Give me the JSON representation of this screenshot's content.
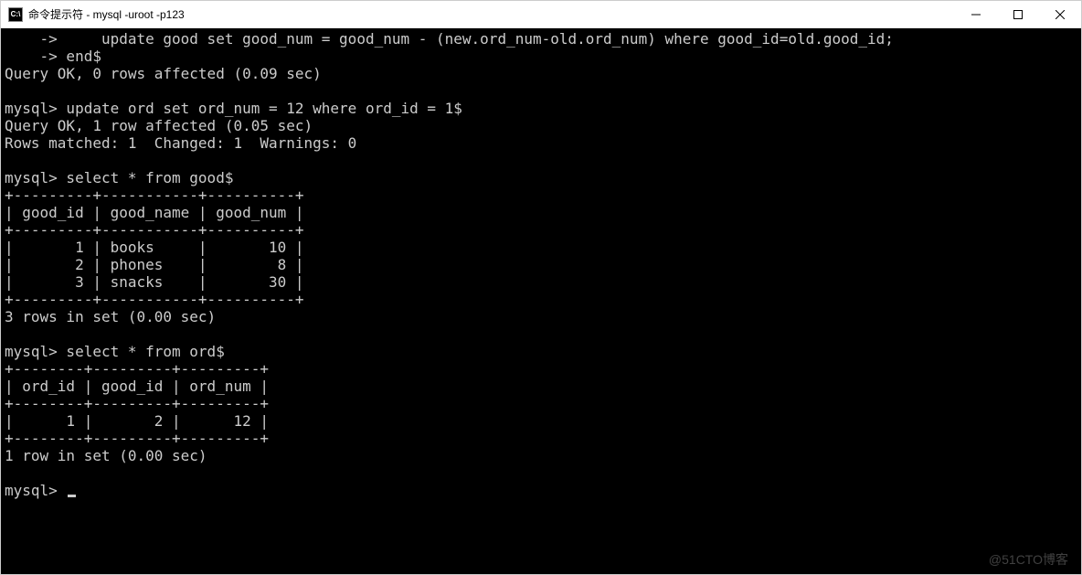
{
  "window": {
    "title": "命令提示符 - mysql  -uroot -p123",
    "icon_label": "C:\\"
  },
  "terminal": {
    "lines": [
      "    ->     update good set good_num = good_num - (new.ord_num-old.ord_num) where good_id=old.good_id;",
      "    -> end$",
      "Query OK, 0 rows affected (0.09 sec)",
      "",
      "mysql> update ord set ord_num = 12 where ord_id = 1$",
      "Query OK, 1 row affected (0.05 sec)",
      "Rows matched: 1  Changed: 1  Warnings: 0",
      "",
      "mysql> select * from good$",
      "+---------+-----------+----------+",
      "| good_id | good_name | good_num |",
      "+---------+-----------+----------+",
      "|       1 | books     |       10 |",
      "|       2 | phones    |        8 |",
      "|       3 | snacks    |       30 |",
      "+---------+-----------+----------+",
      "3 rows in set (0.00 sec)",
      "",
      "mysql> select * from ord$",
      "+--------+---------+---------+",
      "| ord_id | good_id | ord_num |",
      "+--------+---------+---------+",
      "|      1 |       2 |      12 |",
      "+--------+---------+---------+",
      "1 row in set (0.00 sec)",
      "",
      "mysql> "
    ],
    "prompt_end": "mysql> "
  },
  "watermark": "@51CTO博客"
}
